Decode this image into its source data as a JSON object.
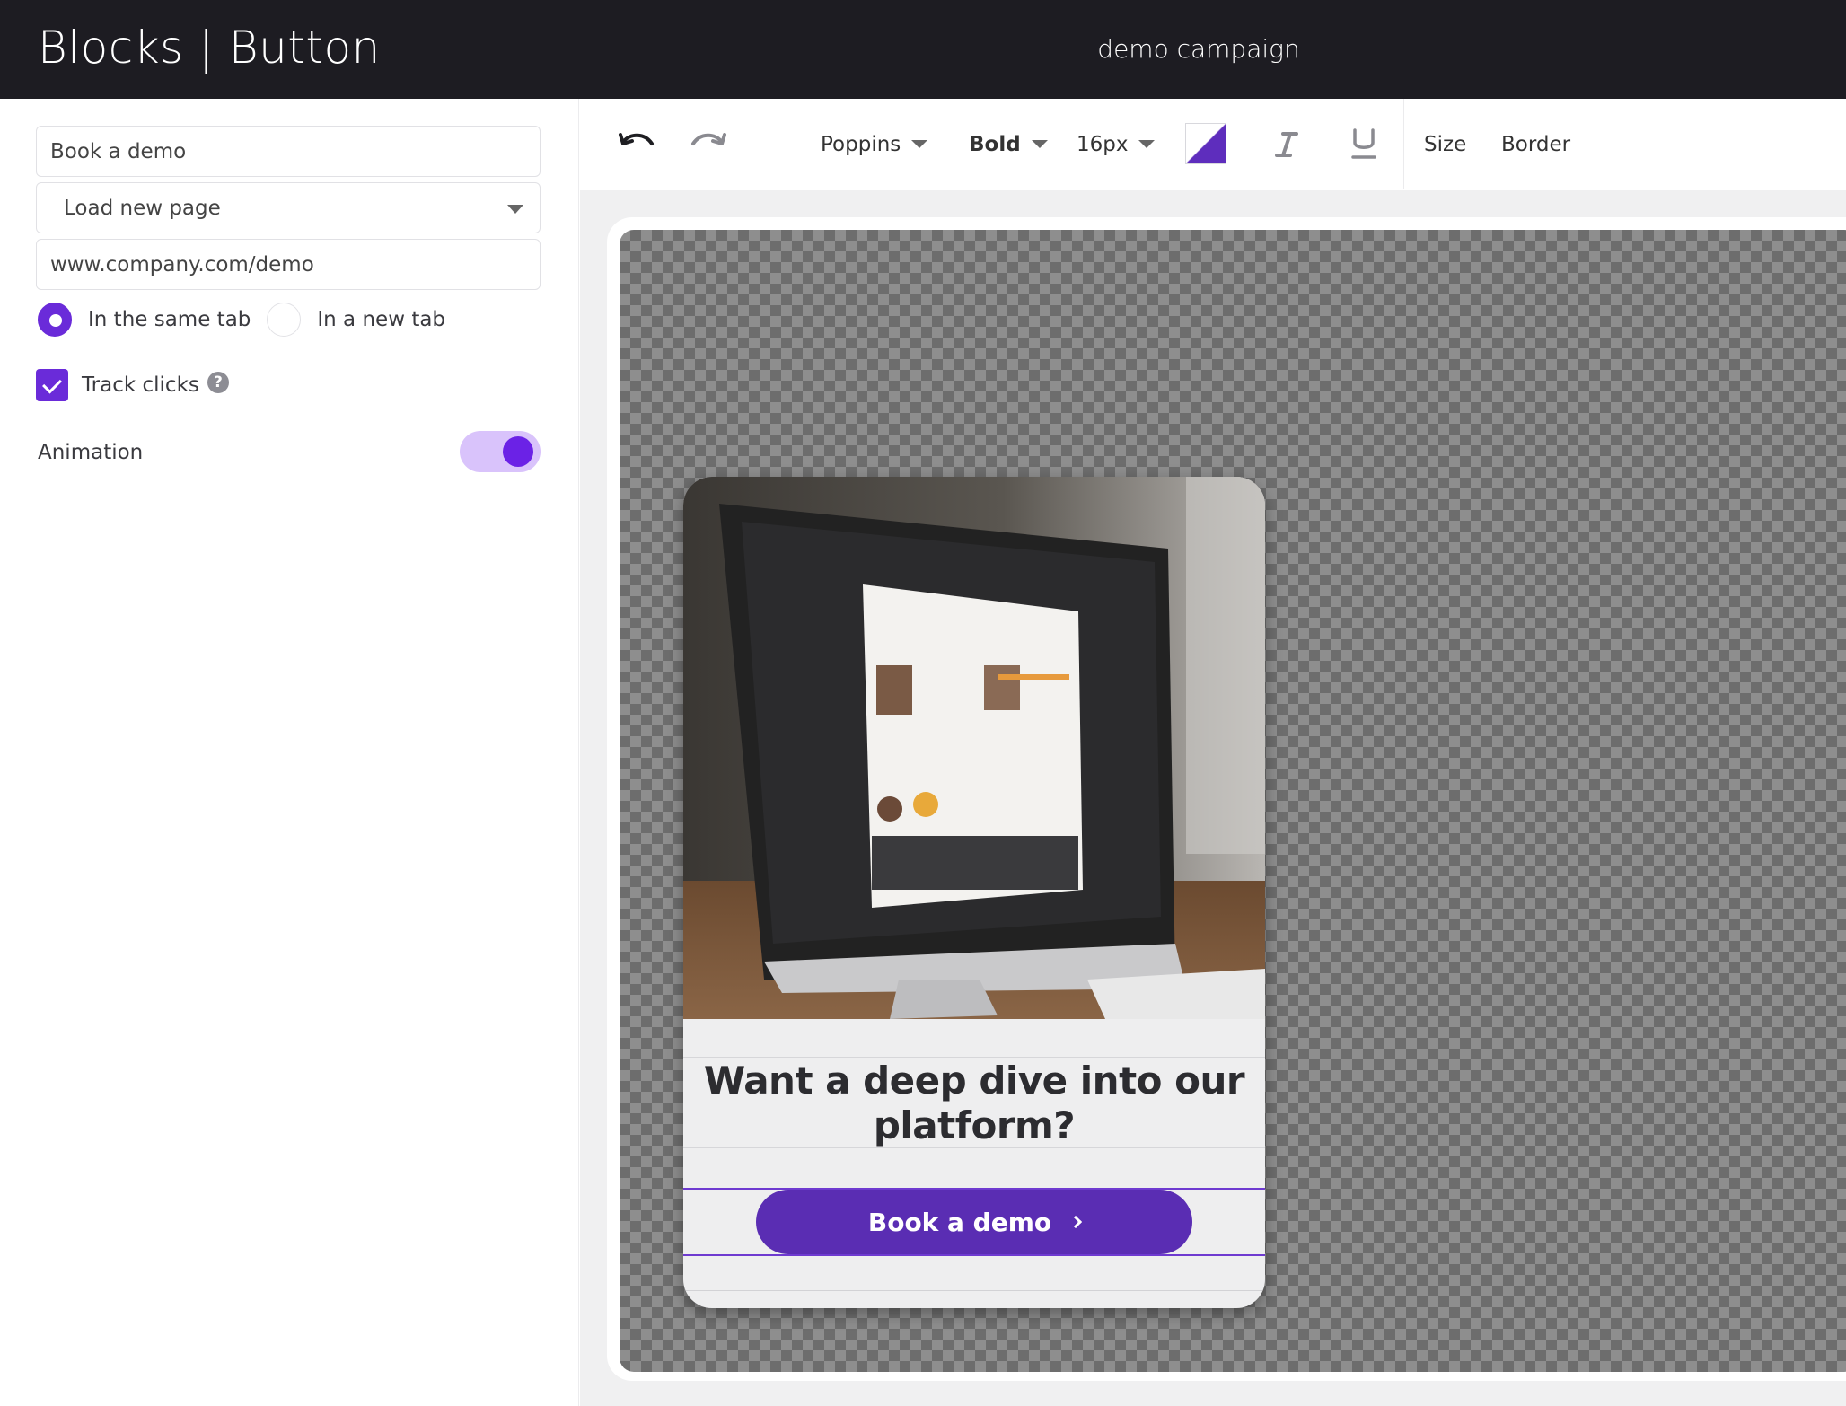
{
  "header": {
    "title": "Blocks | Button",
    "campaign": "demo campaign"
  },
  "settings": {
    "button_text": "Book a demo",
    "action": "Load new page",
    "url": "www.company.com/demo",
    "open_options": [
      "In the same tab",
      "In a new tab"
    ],
    "open_selected": "In the same tab",
    "track_clicks_label": "Track clicks",
    "track_clicks_checked": true,
    "help_glyph": "?",
    "animation_label": "Animation",
    "animation_on": true
  },
  "toolbar": {
    "undo_icon": "undo-icon",
    "redo_icon": "redo-icon",
    "font": "Poppins",
    "weight": "Bold",
    "size": "16px",
    "color": "#5e2dbd",
    "italic_icon": "italic-icon",
    "underline_icon": "underline-icon",
    "size_label": "Size",
    "border_label": "Border"
  },
  "preview": {
    "heading": "Want a deep dive into our platform?",
    "button_label": "Book a demo",
    "button_color": "#5a2db3"
  },
  "colors": {
    "accent": "#6a2bd9",
    "header_bg": "#1d1c22",
    "toggle_track": "#d9c3fb"
  }
}
